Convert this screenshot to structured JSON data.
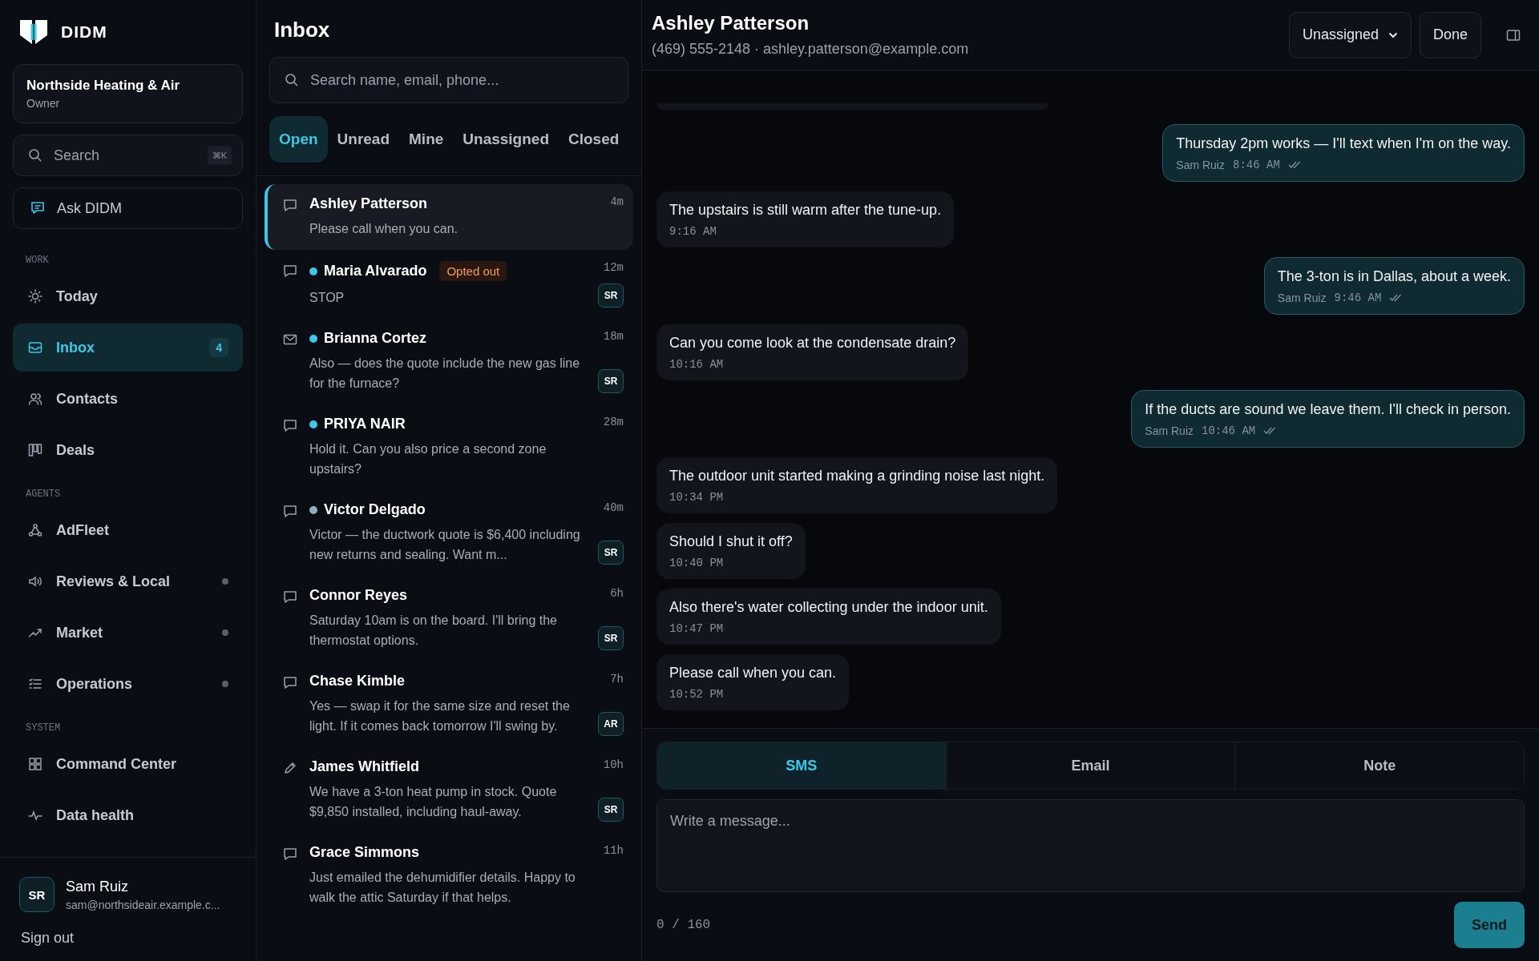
{
  "sidebar": {
    "brand": "DIDM",
    "org": {
      "name": "Northside Heating & Air",
      "role": "Owner"
    },
    "search": {
      "placeholder": "Search",
      "shortcut": "⌘K"
    },
    "ask": "Ask DIDM",
    "sections": [
      {
        "label": "WORK",
        "items": [
          {
            "label": "Today",
            "kind": "sun",
            "selected": false
          },
          {
            "label": "Inbox",
            "kind": "inbox",
            "selected": true,
            "badge": "4"
          },
          {
            "label": "Contacts",
            "kind": "users",
            "selected": false
          },
          {
            "label": "Deals",
            "kind": "board",
            "selected": false
          }
        ]
      },
      {
        "label": "AGENTS",
        "items": [
          {
            "label": "AdFleet",
            "kind": "nodes",
            "selected": false
          },
          {
            "label": "Reviews & Local",
            "kind": "speaker",
            "selected": false,
            "dot": true
          },
          {
            "label": "Market",
            "kind": "trend",
            "selected": false,
            "dot": true
          },
          {
            "label": "Operations",
            "kind": "list",
            "selected": false,
            "dot": true
          }
        ]
      },
      {
        "label": "SYSTEM",
        "items": [
          {
            "label": "Command Center",
            "kind": "grid",
            "selected": false
          },
          {
            "label": "Data health",
            "kind": "pulse",
            "selected": false
          }
        ]
      }
    ],
    "user": {
      "initials": "SR",
      "name": "Sam Ruiz",
      "email": "sam@northsideair.example.c..."
    },
    "sign_out": "Sign out"
  },
  "inbox": {
    "title": "Inbox",
    "search": {
      "placeholder": "Search name, email, phone..."
    },
    "filters": [
      {
        "label": "Open",
        "selected": true
      },
      {
        "label": "Unread",
        "selected": false
      },
      {
        "label": "Mine",
        "selected": false
      },
      {
        "label": "Unassigned",
        "selected": false
      },
      {
        "label": "Closed",
        "selected": false
      }
    ],
    "conversations": [
      {
        "kind": "sms",
        "name": "Ashley Patterson",
        "preview": "Please call when you can.",
        "time": "4m",
        "selected": true
      },
      {
        "kind": "sms",
        "name": "Maria Alvarado",
        "tag": "Opted out",
        "preview": "STOP",
        "time": "12m",
        "assignee": "SR",
        "color": "#3cc8e6",
        "selected": false
      },
      {
        "kind": "email",
        "name": "Brianna Cortez",
        "preview": "Also — does the quote include the new gas line for the furnace?",
        "time": "18m",
        "assignee": "SR",
        "color": "#3cc8e6",
        "selected": false
      },
      {
        "kind": "sms",
        "name": "PRIYA NAIR",
        "preview": "Hold it. Can you also price a second zone upstairs?",
        "time": "28m",
        "color": "#3cc8e6",
        "selected": false
      },
      {
        "kind": "sms",
        "name": "Victor Delgado",
        "preview": "Victor — the ductwork quote is $6,400 including new returns and sealing. Want m...",
        "time": "40m",
        "assignee": "SR",
        "color": "#8fb0ba",
        "selected": false
      },
      {
        "kind": "sms",
        "name": "Connor Reyes",
        "preview": "Saturday 10am is on the board. I'll bring the thermostat options.",
        "time": "6h",
        "assignee": "SR",
        "selected": false
      },
      {
        "kind": "sms",
        "name": "Chase Kimble",
        "preview": "Yes — swap it for the same size and reset the light. If it comes back tomorrow I'll swing by.",
        "time": "7h",
        "assignee": "AR",
        "selected": false
      },
      {
        "kind": "note",
        "name": "James Whitfield",
        "preview": "We have a 3-ton heat pump in stock. Quote $9,850 installed, including haul-away.",
        "time": "10h",
        "assignee": "SR",
        "selected": false
      },
      {
        "kind": "sms",
        "name": "Grace Simmons",
        "preview": "Just emailed the dehumidifier details. Happy to walk the attic Saturday if that helps.",
        "time": "11h",
        "selected": false
      }
    ]
  },
  "conversation": {
    "name": "Ashley Patterson",
    "contact": "(469) 555-2148 · ashley.patterson@example.com",
    "assignee": "Unassigned",
    "done": "Done",
    "messages": [
      {
        "kind": "out",
        "text": "Thursday 2pm works — I'll text when I'm on the way.",
        "sender": "Sam Ruiz",
        "time": "8:46 AM",
        "read": true
      },
      {
        "kind": "in",
        "text": "The upstairs is still warm after the tune-up.",
        "time": "9:16 AM"
      },
      {
        "kind": "out",
        "text": "The 3-ton is in Dallas, about a week.",
        "sender": "Sam Ruiz",
        "time": "9:46 AM",
        "read": true
      },
      {
        "kind": "in",
        "text": "Can you come look at the condensate drain?",
        "time": "10:16 AM"
      },
      {
        "kind": "out",
        "text": "If the ducts are sound we leave them. I'll check in person.",
        "sender": "Sam Ruiz",
        "time": "10:46 AM",
        "read": true
      },
      {
        "kind": "in",
        "text": "The outdoor unit started making a grinding noise last night.",
        "time": "10:34 PM"
      },
      {
        "kind": "in",
        "text": "Should I shut it off?",
        "time": "10:40 PM"
      },
      {
        "kind": "in",
        "text": "Also there's water collecting under the indoor unit.",
        "time": "10:47 PM"
      },
      {
        "kind": "in",
        "text": "Please call when you can.",
        "time": "10:52 PM"
      }
    ],
    "composer": {
      "tabs": [
        {
          "label": "SMS",
          "selected": true
        },
        {
          "label": "Email",
          "selected": false
        },
        {
          "label": "Note",
          "selected": false
        }
      ],
      "placeholder": "Write a message...",
      "count": "0 / 160",
      "send": "Send"
    }
  }
}
